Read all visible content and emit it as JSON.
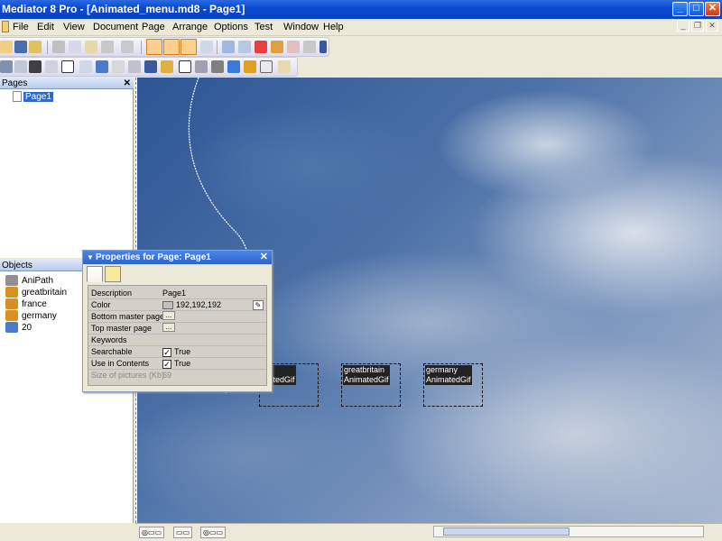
{
  "window": {
    "title": "Mediator 8 Pro - [Animated_menu.md8 - Page1]",
    "min": "_",
    "max": "□",
    "close": "✕"
  },
  "menu": [
    "File",
    "Edit",
    "View",
    "Document",
    "Page",
    "Arrange",
    "Options",
    "Test",
    "Window",
    "Help"
  ],
  "pages_panel": {
    "title": "Pages",
    "close": "✕",
    "items": [
      "Page1"
    ]
  },
  "objects_panel": {
    "title": "Objects",
    "items": [
      "AniPath",
      "greatbritain",
      "france",
      "germany",
      "20"
    ]
  },
  "properties": {
    "title": "Properties for Page: Page1",
    "close": "✕",
    "rows": [
      {
        "name": "Description",
        "value": "Page1"
      },
      {
        "name": "Color",
        "value": "192,192,192"
      },
      {
        "name": "Bottom master page",
        "value": "..."
      },
      {
        "name": "Top master page",
        "value": "..."
      },
      {
        "name": "Keywords",
        "value": ""
      },
      {
        "name": "Searchable",
        "value": "True"
      },
      {
        "name": "Use in Contents",
        "value": "True"
      },
      {
        "name": "Size of pictures (Kb)",
        "value": "69"
      }
    ]
  },
  "canvas_objects": [
    {
      "line1": "ce",
      "line2": "matedGif"
    },
    {
      "line1": "greatbritain",
      "line2": "AnimatedGif"
    },
    {
      "line1": "germany",
      "line2": "AnimatedGif"
    }
  ],
  "colors": {
    "title_bar": "#0a4ad2",
    "selection": "#316ac5",
    "panel_header": "#b8cbec"
  }
}
